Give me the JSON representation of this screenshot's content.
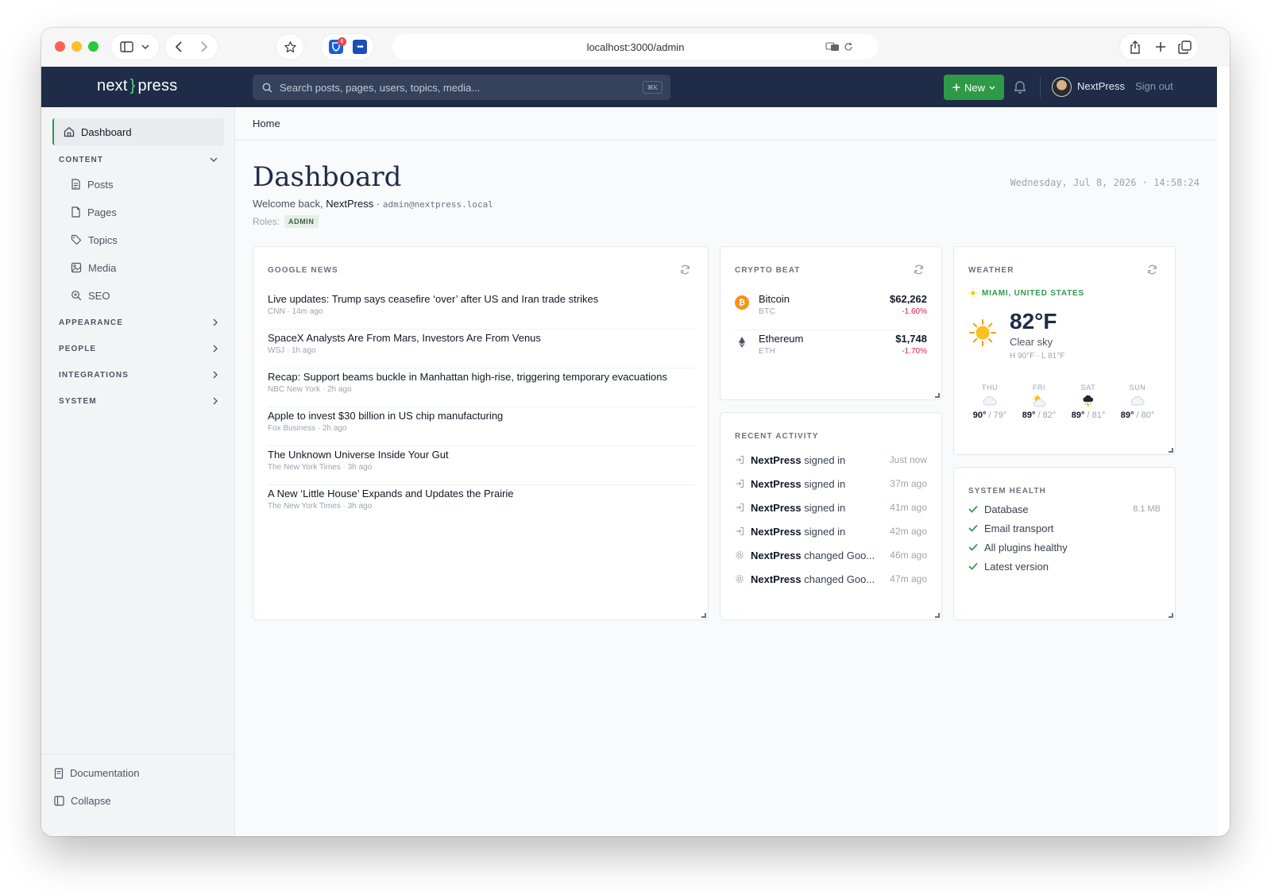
{
  "browser": {
    "url": "localhost:3000/admin",
    "ext_badge": "6"
  },
  "topbar": {
    "logo_left": "next",
    "logo_brace": "}",
    "logo_right": "press",
    "search_placeholder": "Search posts, pages, users, topics, media...",
    "search_shortcut": "⌘K",
    "new_label": "New",
    "user_name": "NextPress",
    "signout_label": "Sign out"
  },
  "sidebar": {
    "active": "Dashboard",
    "content_section": "CONTENT",
    "content_items": [
      "Posts",
      "Pages",
      "Topics",
      "Media",
      "SEO"
    ],
    "sections": [
      "APPEARANCE",
      "PEOPLE",
      "INTEGRATIONS",
      "SYSTEM"
    ],
    "documentation": "Documentation",
    "collapse": "Collapse"
  },
  "breadcrumb": "Home",
  "header": {
    "title": "Dashboard",
    "welcome_prefix": "Welcome back,",
    "welcome_name": "NextPress",
    "separator": "·",
    "email": "admin@nextpress.local",
    "roles_label": "Roles:",
    "role": "ADMIN",
    "datetime": "Wednesday, Jul 8, 2026 · 14:58:24"
  },
  "news": {
    "title": "GOOGLE NEWS",
    "items": [
      {
        "title": "Live updates: Trump says ceasefire ‘over’ after US and Iran trade strikes",
        "meta": "CNN · 14m ago"
      },
      {
        "title": "SpaceX Analysts Are From Mars, Investors Are From Venus",
        "meta": "WSJ · 1h ago"
      },
      {
        "title": "Recap: Support beams buckle in Manhattan high-rise, triggering temporary evacuations",
        "meta": "NBC New York · 2h ago"
      },
      {
        "title": "Apple to invest $30 billion in US chip manufacturing",
        "meta": "Fox Business · 2h ago"
      },
      {
        "title": "The Unknown Universe Inside Your Gut",
        "meta": "The New York Times · 3h ago"
      },
      {
        "title": "A New ‘Little House’ Expands and Updates the Prairie",
        "meta": "The New York Times · 3h ago"
      }
    ]
  },
  "crypto": {
    "title": "CRYPTO BEAT",
    "coins": [
      {
        "name": "Bitcoin",
        "symbol": "BTC",
        "price": "$62,262",
        "change": "-1.60%",
        "color": "#f7931a"
      },
      {
        "name": "Ethereum",
        "symbol": "ETH",
        "price": "$1,748",
        "change": "-1.70%",
        "color": "#4b5563"
      }
    ]
  },
  "activity": {
    "title": "RECENT ACTIVITY",
    "items": [
      {
        "who": "NextPress",
        "action": "signed in",
        "time": "Just now",
        "icon": "sign-in-icon"
      },
      {
        "who": "NextPress",
        "action": "signed in",
        "time": "37m ago",
        "icon": "sign-in-icon"
      },
      {
        "who": "NextPress",
        "action": "signed in",
        "time": "41m ago",
        "icon": "sign-in-icon"
      },
      {
        "who": "NextPress",
        "action": "signed in",
        "time": "42m ago",
        "icon": "sign-in-icon"
      },
      {
        "who": "NextPress",
        "action": "changed Goo...",
        "time": "46m ago",
        "icon": "settings-icon"
      },
      {
        "who": "NextPress",
        "action": "changed Goo...",
        "time": "47m ago",
        "icon": "settings-icon"
      }
    ]
  },
  "weather": {
    "title": "WEATHER",
    "location": "MIAMI, UNITED STATES",
    "temp": "82°F",
    "condition": "Clear sky",
    "hilo": "H 90°F · L 81°F",
    "forecast": [
      {
        "day": "THU",
        "hi": "90°",
        "lo": "/ 79°",
        "icon": "cloud-icon"
      },
      {
        "day": "FRI",
        "hi": "89°",
        "lo": "/ 82°",
        "icon": "sun-cloud-icon"
      },
      {
        "day": "SAT",
        "hi": "89°",
        "lo": "/ 81°",
        "icon": "storm-cloud-icon"
      },
      {
        "day": "SUN",
        "hi": "89°",
        "lo": "/ 80°",
        "icon": "cloud-icon"
      }
    ]
  },
  "health": {
    "title": "SYSTEM HEALTH",
    "items": [
      {
        "label": "Database",
        "value": "8.1 MB"
      },
      {
        "label": "Email transport",
        "value": ""
      },
      {
        "label": "All plugins healthy",
        "value": ""
      },
      {
        "label": "Latest version",
        "value": ""
      }
    ]
  },
  "colors": {
    "navy": "#1e2c47",
    "accent": "#2e9a48",
    "negative": "#e11d48"
  }
}
